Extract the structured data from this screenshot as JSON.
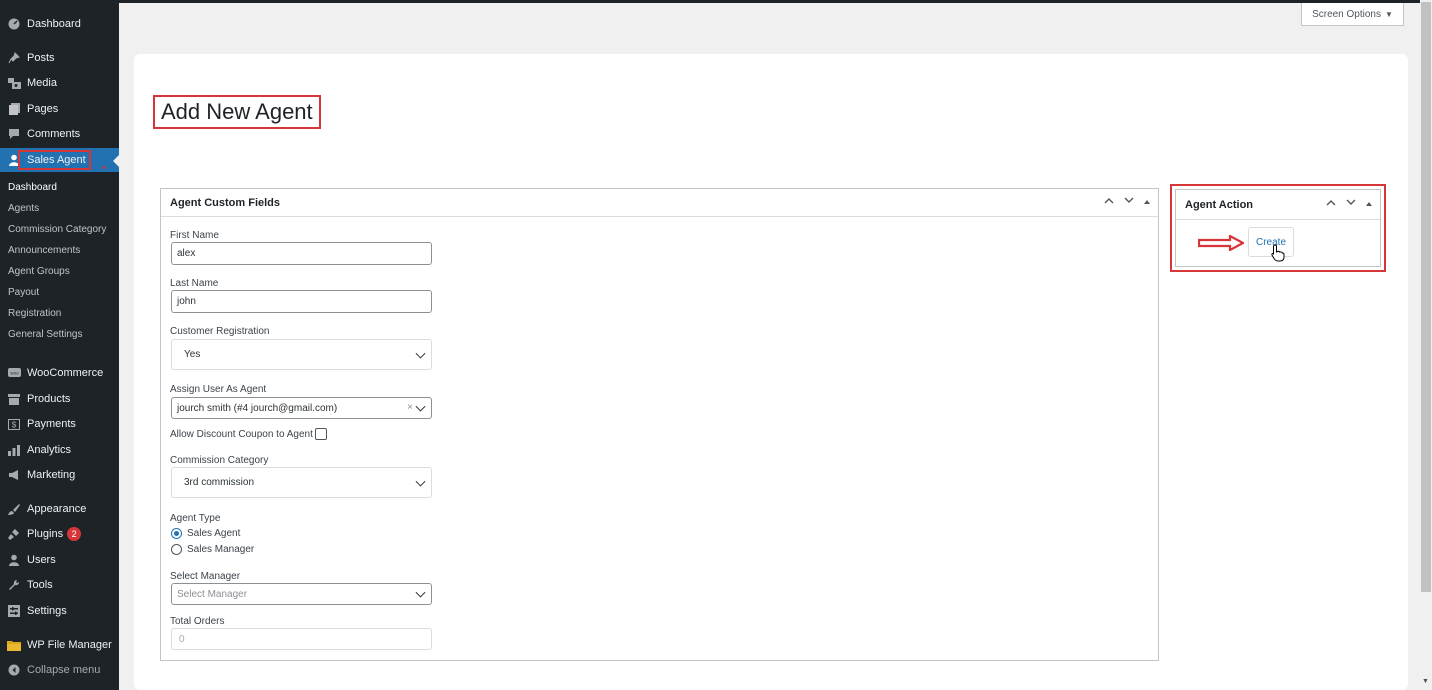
{
  "sidebar": {
    "items": [
      {
        "label": "Dashboard",
        "icon": "dashboard-icon"
      },
      {
        "label": "Posts",
        "icon": "pin-icon"
      },
      {
        "label": "Media",
        "icon": "media-icon"
      },
      {
        "label": "Pages",
        "icon": "pages-icon"
      },
      {
        "label": "Comments",
        "icon": "comment-icon"
      },
      {
        "label": "Sales Agent",
        "icon": "user-icon"
      },
      {
        "label": "WooCommerce",
        "icon": "woo-icon"
      },
      {
        "label": "Products",
        "icon": "archive-icon"
      },
      {
        "label": "Payments",
        "icon": "dollar-icon"
      },
      {
        "label": "Analytics",
        "icon": "chart-bar-icon"
      },
      {
        "label": "Marketing",
        "icon": "megaphone-icon"
      },
      {
        "label": "Appearance",
        "icon": "brush-icon"
      },
      {
        "label": "Plugins",
        "icon": "plugin-icon",
        "badge": "2"
      },
      {
        "label": "Users",
        "icon": "users-icon"
      },
      {
        "label": "Tools",
        "icon": "wrench-icon"
      },
      {
        "label": "Settings",
        "icon": "settings-icon"
      },
      {
        "label": "WP File Manager",
        "icon": "folder-icon"
      },
      {
        "label": "Collapse menu",
        "icon": "collapse-icon"
      }
    ],
    "submenu": [
      "Dashboard",
      "Agents",
      "Commission Category",
      "Announcements",
      "Agent Groups",
      "Payout",
      "Registration",
      "General Settings"
    ]
  },
  "screen_options": {
    "label": "Screen Options",
    "arrow": "▼"
  },
  "page": {
    "title": "Add New Agent"
  },
  "fields_box": {
    "title": "Agent Custom Fields",
    "first_name": {
      "label": "First Name",
      "value": "alex"
    },
    "last_name": {
      "label": "Last Name",
      "value": "john"
    },
    "customer_registration": {
      "label": "Customer Registration",
      "value": "Yes"
    },
    "assign_user": {
      "label": "Assign User As Agent",
      "value": "jourch smith (#4 jourch@gmail.com)",
      "clear": "×"
    },
    "discount_coupon": {
      "label": "Allow Discount Coupon to Agent"
    },
    "commission_category": {
      "label": "Commission Category",
      "value": "3rd commission"
    },
    "agent_type": {
      "label": "Agent Type",
      "options": [
        "Sales Agent",
        "Sales Manager"
      ],
      "selected": "Sales Agent"
    },
    "select_manager": {
      "label": "Select Manager",
      "placeholder": "Select Manager"
    },
    "total_orders": {
      "label": "Total Orders",
      "value": "0"
    }
  },
  "action_box": {
    "title": "Agent Action",
    "create_label": "Create"
  },
  "colors": {
    "accent": "#2271b1",
    "highlight": "#d63638",
    "sidebar_bg": "#1d2327"
  }
}
